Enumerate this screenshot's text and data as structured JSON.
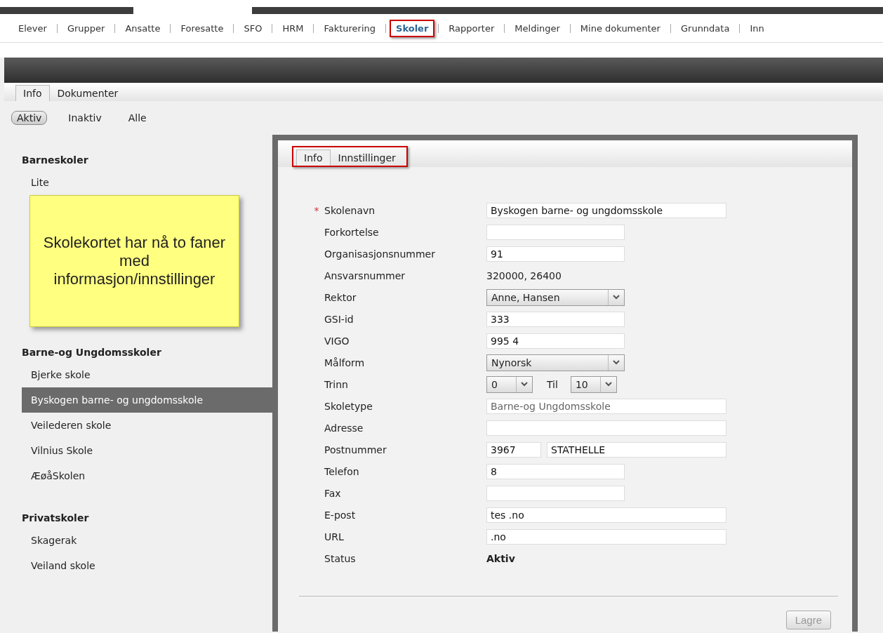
{
  "menu": [
    {
      "label": "Elever",
      "selected": false
    },
    {
      "label": "Grupper",
      "selected": false
    },
    {
      "label": "Ansatte",
      "selected": false
    },
    {
      "label": "Foresatte",
      "selected": false
    },
    {
      "label": "SFO",
      "selected": false
    },
    {
      "label": "HRM",
      "selected": false
    },
    {
      "label": "Fakturering",
      "selected": false
    },
    {
      "label": "Skoler",
      "selected": true
    },
    {
      "label": "Rapporter",
      "selected": false
    },
    {
      "label": "Meldinger",
      "selected": false
    },
    {
      "label": "Mine dokumenter",
      "selected": false
    },
    {
      "label": "Grunndata",
      "selected": false
    },
    {
      "label": "Inn",
      "selected": false
    }
  ],
  "page_tabs": [
    {
      "label": "Info",
      "selected": true
    },
    {
      "label": "Dokumenter",
      "selected": false
    }
  ],
  "filters": [
    {
      "label": "Aktiv",
      "selected": true
    },
    {
      "label": "Inaktiv",
      "selected": false
    },
    {
      "label": "Alle",
      "selected": false
    }
  ],
  "groups": [
    {
      "title": "Barneskoler",
      "items": [
        {
          "label": "Lite",
          "selected": false
        }
      ]
    },
    {
      "title": "Barne-og Ungdomsskoler",
      "items": [
        {
          "label": "Bjerke skole",
          "selected": false
        },
        {
          "label": "Byskogen barne- og ungdomsskole",
          "selected": true
        },
        {
          "label": "Veilederen skole",
          "selected": false
        },
        {
          "label": "Vilnius Skole",
          "selected": false
        },
        {
          "label": "ÆøåSkolen",
          "selected": false
        }
      ]
    },
    {
      "title": "Privatskoler",
      "items": [
        {
          "label": "Skagerak",
          "selected": false
        },
        {
          "label": "Veiland skole",
          "selected": false
        }
      ]
    }
  ],
  "note": {
    "text": "Skolekortet har nå to faner med informasjon/innstillinger"
  },
  "card_tabs": [
    {
      "label": "Info",
      "selected": true
    },
    {
      "label": "Innstillinger",
      "selected": false
    }
  ],
  "fields": [
    {
      "kind": "wide",
      "label": "Skolenavn",
      "required_mark": "*",
      "value": "Byskogen barne- og ungdomsskole"
    },
    {
      "kind": "text",
      "label": "Forkortelse"
    },
    {
      "kind": "text",
      "label": "Organisasjonsnummer",
      "value": "91"
    },
    {
      "kind": "static",
      "label": "Ansvarsnummer",
      "value": "320000, 26400"
    },
    {
      "kind": "select",
      "label": "Rektor",
      "value": "Anne, Hansen"
    },
    {
      "kind": "text",
      "label": "GSI-id",
      "value": "333"
    },
    {
      "kind": "text",
      "label": "VIGO",
      "value": "995 4"
    },
    {
      "kind": "select",
      "label": "Målform",
      "value": "Nynorsk"
    },
    {
      "kind": "range",
      "label": "Trinn",
      "from": "0",
      "to_label": "Til",
      "to": "10"
    },
    {
      "kind": "wide",
      "label": "Skoletype",
      "value": "Barne-og Ungdomsskole",
      "disabled": true
    },
    {
      "kind": "wide",
      "label": "Adresse"
    },
    {
      "kind": "pair",
      "label": "Postnummer",
      "value": "3967",
      "value2": "STATHELLE"
    },
    {
      "kind": "text",
      "label": "Telefon",
      "value": "8"
    },
    {
      "kind": "text",
      "label": "Fax"
    },
    {
      "kind": "wide",
      "label": "E-post",
      "value": "tes .no"
    },
    {
      "kind": "wide",
      "label": "URL",
      "value": ".no"
    },
    {
      "kind": "bold",
      "label": "Status",
      "value": "Aktiv"
    }
  ],
  "save_button": {
    "label": "Lagre",
    "disabled": true
  }
}
